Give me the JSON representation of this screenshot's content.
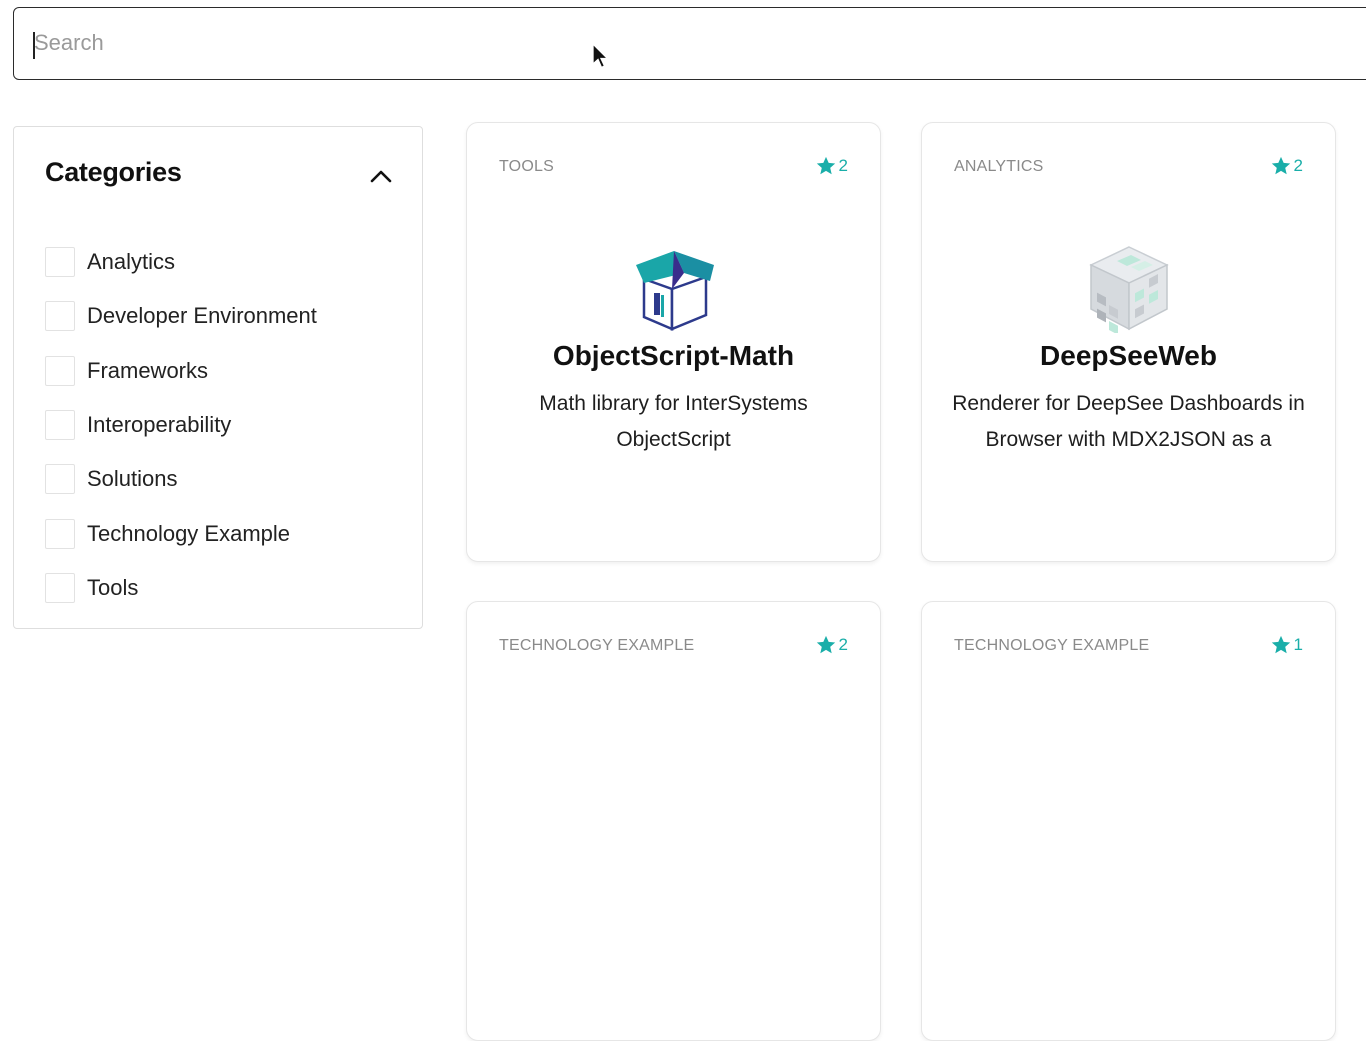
{
  "search": {
    "placeholder": "Search",
    "value": ""
  },
  "sidebar": {
    "title": "Categories",
    "items": [
      {
        "label": "Analytics",
        "checked": false
      },
      {
        "label": "Developer Environment",
        "checked": false
      },
      {
        "label": "Frameworks",
        "checked": false
      },
      {
        "label": "Interoperability",
        "checked": false
      },
      {
        "label": "Solutions",
        "checked": false
      },
      {
        "label": "Technology Example",
        "checked": false
      },
      {
        "label": "Tools",
        "checked": false
      }
    ]
  },
  "cards": [
    {
      "category": "TOOLS",
      "stars": "2",
      "title": "ObjectScript-Math",
      "description": "Math library for InterSystems ObjectScript",
      "logo_icon": "open-box-icon"
    },
    {
      "category": "ANALYTICS",
      "stars": "2",
      "title": "DeepSeeWeb",
      "description": "Renderer for DeepSee Dashboards in Browser with MDX2JSON as a",
      "logo_icon": "data-cube-icon"
    },
    {
      "category": "TECHNOLOGY EXAMPLE",
      "stars": "2",
      "title": "",
      "description": ""
    },
    {
      "category": "TECHNOLOGY EXAMPLE",
      "stars": "1",
      "title": "",
      "description": ""
    }
  ],
  "colors": {
    "accent": "#1aaea9",
    "border": "#dedede"
  }
}
